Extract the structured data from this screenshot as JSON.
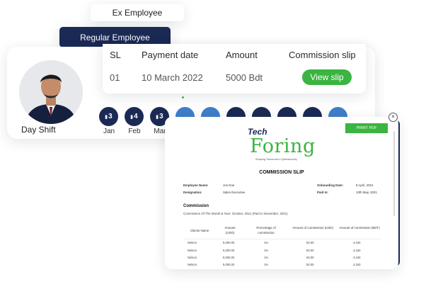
{
  "chips": {
    "ex_employee": "Ex Employee",
    "regular_employee": "Regular Employee"
  },
  "profile": {
    "shift": "Day Shift"
  },
  "payments": {
    "headers": [
      "SL",
      "Payment date",
      "Amount",
      "Commission slip"
    ],
    "rows": [
      {
        "sl": "01",
        "date": "10 March 2022",
        "amount": "5000 Bdt",
        "action": "View slip"
      }
    ]
  },
  "months": [
    {
      "count": "3",
      "label": "Jan"
    },
    {
      "count": "4",
      "label": "Feb"
    },
    {
      "count": "3",
      "label": "Mar"
    }
  ],
  "slip": {
    "print_label": "PRINT PDF",
    "logo_tech": "Tech",
    "logo_main": "Foring",
    "logo_tagline": "Shaping Tomorrow's Cybersecurity",
    "title": "COMMISSION SLIP",
    "fields": {
      "employee_name_label": "Employee Name:",
      "employee_name": "Jon Doe",
      "designation_label": "Designation:",
      "designation": "Sales Executive",
      "onboarding_label": "Onboarding Date:",
      "onboarding": "8 April, 2021",
      "paid_in_label": "Paid In:",
      "paid_in": "10th May, 2021"
    },
    "commission_heading": "Commission",
    "commission_sub": "Commission Of The Month & Year: October, 2021 (Paid In November, 2021)",
    "columns": [
      "Clients Name",
      "Amount (USD)",
      "Percentage of commission",
      "Amount of commission (USD)",
      "Amount of commission (BDT)"
    ],
    "rows": [
      [
        "Nelson",
        "5,000.00",
        "1%",
        "50.00",
        "4,150"
      ],
      [
        "Nelson",
        "5,000.00",
        "1%",
        "50.00",
        "4,150"
      ],
      [
        "Nelson",
        "5,000.00",
        "1%",
        "50.00",
        "4,150"
      ],
      [
        "Nelson",
        "5,000.00",
        "1%",
        "50.00",
        "4,150"
      ]
    ]
  },
  "colors": {
    "navy": "#1b2a55",
    "green": "#3bb441",
    "blue": "#3f7fc9"
  }
}
